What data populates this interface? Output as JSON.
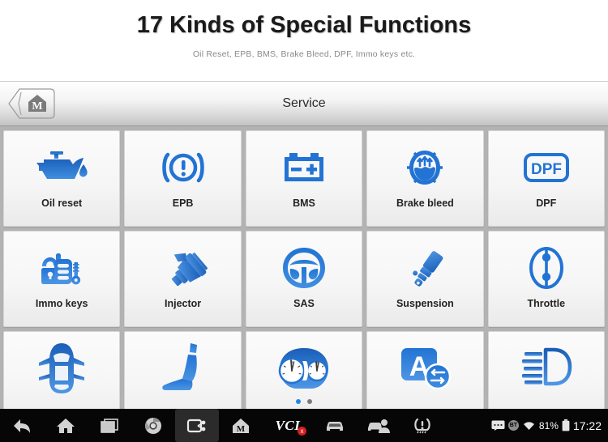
{
  "promo": {
    "title": "17 Kinds of Special Functions",
    "subtitle": "Oil Reset, EPB, BMS, Brake Bleed, DPF, Immo keys etc."
  },
  "colors": {
    "icon_blue": "#2273d4",
    "icon_blue_dark": "#1a5fb8",
    "accent_dot": "#1e86e8",
    "vci_error": "#d81f22"
  },
  "appbar": {
    "title": "Service",
    "home_button": "maxisys-home-icon",
    "home_letter": "M"
  },
  "grid": {
    "tiles": [
      {
        "label": "Oil reset",
        "icon": "oil-can-icon"
      },
      {
        "label": "EPB",
        "icon": "epb-brake-icon"
      },
      {
        "label": "BMS",
        "icon": "battery-icon"
      },
      {
        "label": "Brake bleed",
        "icon": "brake-bleed-icon"
      },
      {
        "label": "DPF",
        "icon": "dpf-icon",
        "icon_text": "DPF"
      },
      {
        "label": "Immo keys",
        "icon": "immo-key-lock-icon"
      },
      {
        "label": "Injector",
        "icon": "injector-icon"
      },
      {
        "label": "SAS",
        "icon": "steering-wheel-icon"
      },
      {
        "label": "Suspension",
        "icon": "suspension-shock-icon"
      },
      {
        "label": "Throttle",
        "icon": "throttle-body-icon"
      },
      {
        "label": "",
        "icon": "car-top-view-icon"
      },
      {
        "label": "",
        "icon": "car-seat-icon"
      },
      {
        "label": "",
        "icon": "instrument-cluster-icon"
      },
      {
        "label": "",
        "icon": "language-change-icon",
        "icon_text": "A"
      },
      {
        "label": "",
        "icon": "headlight-icon"
      }
    ]
  },
  "pager": {
    "pages": 2,
    "active": 1
  },
  "navbar": {
    "items": [
      {
        "name": "back-icon",
        "selected": false
      },
      {
        "name": "home-icon",
        "selected": false
      },
      {
        "name": "recents-icon",
        "selected": false
      },
      {
        "name": "chrome-icon",
        "selected": false
      },
      {
        "name": "screenshot-icon",
        "selected": true
      },
      {
        "name": "maxisys-house-icon",
        "selected": false
      }
    ],
    "vci": {
      "label": "VCI",
      "status": "x"
    },
    "tools": [
      {
        "name": "vehicle-icon"
      },
      {
        "name": "remote-support-icon"
      },
      {
        "name": "tpms-icon"
      }
    ],
    "status": {
      "message_icon": "message-icon",
      "bluetooth_label": "BT",
      "wifi_icon": "wifi-icon",
      "battery_percent": "81%",
      "battery_icon": "battery-icon",
      "clock": "17:22"
    }
  }
}
